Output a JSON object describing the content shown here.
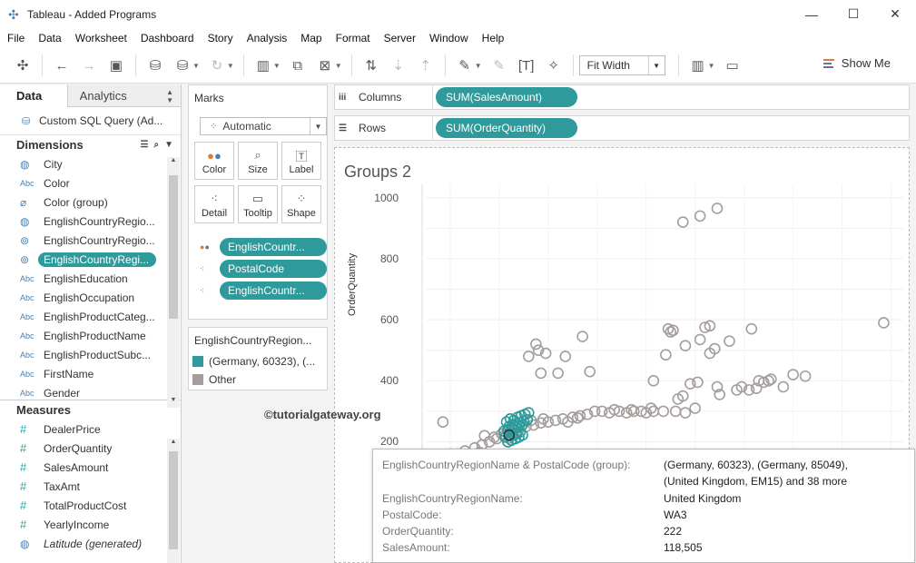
{
  "window": {
    "title": "Tableau - Added Programs",
    "minimize": "—",
    "maximize": "☐",
    "close": "✕"
  },
  "menu": [
    "File",
    "Data",
    "Worksheet",
    "Dashboard",
    "Story",
    "Analysis",
    "Map",
    "Format",
    "Server",
    "Window",
    "Help"
  ],
  "toolbar": {
    "fit": "Fit Width",
    "show_me": "Show Me"
  },
  "data_pane": {
    "tab_data": "Data",
    "tab_analytics": "Analytics",
    "datasource": "Custom SQL Query (Ad...",
    "dimensions_header": "Dimensions",
    "dimensions": [
      {
        "type": "globe",
        "name": "City"
      },
      {
        "type": "Abc",
        "name": "Color"
      },
      {
        "type": "clip",
        "name": "Color (group)"
      },
      {
        "type": "globe",
        "name": "EnglishCountryRegio..."
      },
      {
        "type": "clip2",
        "name": "EnglishCountryRegio..."
      },
      {
        "type": "clip2",
        "name": "EnglishCountryRegi...",
        "selected": true
      },
      {
        "type": "Abc",
        "name": "EnglishEducation"
      },
      {
        "type": "Abc",
        "name": "EnglishOccupation"
      },
      {
        "type": "Abc",
        "name": "EnglishProductCateg..."
      },
      {
        "type": "Abc",
        "name": "EnglishProductName"
      },
      {
        "type": "Abc",
        "name": "EnglishProductSubc..."
      },
      {
        "type": "Abc",
        "name": "FirstName"
      },
      {
        "type": "Abc",
        "name": "Gender"
      }
    ],
    "measures_header": "Measures",
    "measures": [
      {
        "type": "#",
        "name": "DealerPrice"
      },
      {
        "type": "#",
        "name": "OrderQuantity"
      },
      {
        "type": "#",
        "name": "SalesAmount"
      },
      {
        "type": "#",
        "name": "TaxAmt"
      },
      {
        "type": "#",
        "name": "TotalProductCost"
      },
      {
        "type": "#",
        "name": "YearlyIncome"
      },
      {
        "type": "globe",
        "name": "Latitude (generated)",
        "italic": true
      }
    ]
  },
  "marks": {
    "title": "Marks",
    "mark_type": "Automatic",
    "buttons": [
      "Color",
      "Size",
      "Label",
      "Detail",
      "Tooltip",
      "Shape"
    ],
    "pills": [
      "EnglishCountr...",
      "PostalCode",
      "EnglishCountr..."
    ]
  },
  "legend": {
    "title": "EnglishCountryRegion...",
    "items": [
      {
        "label": "(Germany, 60323), (...",
        "color": "#2e9a9c"
      },
      {
        "label": "Other",
        "color": "#a39d9b"
      }
    ]
  },
  "shelves": {
    "columns_label": "Columns",
    "columns_pill": "SUM(SalesAmount)",
    "rows_label": "Rows",
    "rows_pill": "SUM(OrderQuantity)"
  },
  "view": {
    "title": "Groups 2",
    "y_axis_title": "OrderQuantity",
    "watermark": "©tutorialgateway.org"
  },
  "chart_data": {
    "type": "scatter",
    "title": "Groups 2",
    "ylabel": "OrderQuantity",
    "xlabel": "",
    "ylim": [
      130,
      1020
    ],
    "y_ticks": [
      200,
      400,
      600,
      800,
      1000
    ],
    "grid": true,
    "series": [
      {
        "name": "Other",
        "color": "#a39d9b",
        "points": [
          [
            9500,
            920
          ],
          [
            10200,
            940
          ],
          [
            10900,
            965
          ],
          [
            17700,
            590
          ],
          [
            12300,
            570
          ],
          [
            8900,
            570
          ],
          [
            9000,
            560
          ],
          [
            10600,
            580
          ],
          [
            10400,
            575
          ],
          [
            9100,
            565
          ],
          [
            8800,
            485
          ],
          [
            9600,
            515
          ],
          [
            10200,
            535
          ],
          [
            10800,
            505
          ],
          [
            11400,
            530
          ],
          [
            10600,
            490
          ],
          [
            3500,
            520
          ],
          [
            3200,
            480
          ],
          [
            3600,
            500
          ],
          [
            3900,
            490
          ],
          [
            4700,
            480
          ],
          [
            5400,
            545
          ],
          [
            5700,
            430
          ],
          [
            4400,
            425
          ],
          [
            3700,
            425
          ],
          [
            10100,
            395
          ],
          [
            10900,
            380
          ],
          [
            11700,
            370
          ],
          [
            12600,
            400
          ],
          [
            13100,
            405
          ],
          [
            12800,
            395
          ],
          [
            13000,
            400
          ],
          [
            14000,
            420
          ],
          [
            14500,
            415
          ],
          [
            11000,
            355
          ],
          [
            11900,
            380
          ],
          [
            12200,
            370
          ],
          [
            12500,
            375
          ],
          [
            13600,
            380
          ],
          [
            9800,
            390
          ],
          [
            9500,
            350
          ],
          [
            9300,
            340
          ],
          [
            8300,
            400
          ],
          [
            9200,
            300
          ],
          [
            9600,
            295
          ],
          [
            10000,
            310
          ],
          [
            8700,
            300
          ],
          [
            8300,
            300
          ],
          [
            8000,
            295
          ],
          [
            7800,
            300
          ],
          [
            7500,
            300
          ],
          [
            7200,
            295
          ],
          [
            6900,
            300
          ],
          [
            6500,
            295
          ],
          [
            6200,
            300
          ],
          [
            5900,
            300
          ],
          [
            5600,
            290
          ],
          [
            5300,
            285
          ],
          [
            5000,
            280
          ],
          [
            4600,
            275
          ],
          [
            4300,
            270
          ],
          [
            4000,
            265
          ],
          [
            3700,
            262
          ],
          [
            3400,
            255
          ],
          [
            3100,
            250
          ],
          [
            2800,
            240
          ],
          [
            2500,
            230
          ],
          [
            2200,
            220
          ],
          [
            1900,
            210
          ],
          [
            1600,
            200
          ],
          [
            1300,
            190
          ],
          [
            1000,
            180
          ],
          [
            600,
            170
          ],
          [
            300,
            160
          ],
          [
            1100,
            145
          ],
          [
            400,
            140
          ],
          [
            0,
            160
          ],
          [
            -300,
            265
          ],
          [
            1400,
            220
          ],
          [
            1800,
            215
          ],
          [
            2100,
            225
          ],
          [
            2400,
            212
          ],
          [
            2700,
            225
          ],
          [
            2900,
            250
          ],
          [
            3300,
            270
          ],
          [
            3800,
            275
          ],
          [
            4800,
            265
          ],
          [
            5200,
            278
          ],
          [
            6700,
            305
          ],
          [
            7400,
            305
          ],
          [
            8200,
            310
          ],
          [
            1200,
            165
          ],
          [
            800,
            150
          ]
        ]
      },
      {
        "name": "(Germany, 60323), (...",
        "color": "#2e9a9c",
        "points": [
          [
            2300,
            265
          ],
          [
            2450,
            275
          ],
          [
            2600,
            270
          ],
          [
            2750,
            280
          ],
          [
            2900,
            285
          ],
          [
            3050,
            290
          ],
          [
            3200,
            295
          ],
          [
            2400,
            250
          ],
          [
            2550,
            255
          ],
          [
            2700,
            258
          ],
          [
            2850,
            262
          ],
          [
            3000,
            268
          ],
          [
            3150,
            272
          ],
          [
            2200,
            235
          ],
          [
            2350,
            240
          ],
          [
            2500,
            245
          ],
          [
            2650,
            248
          ],
          [
            2800,
            252
          ],
          [
            2950,
            256
          ],
          [
            2250,
            215
          ],
          [
            2400,
            220
          ],
          [
            2550,
            225
          ],
          [
            2700,
            228
          ],
          [
            2850,
            232
          ],
          [
            2350,
            200
          ],
          [
            2500,
            205
          ],
          [
            2650,
            210
          ],
          [
            2800,
            215
          ],
          [
            2950,
            222
          ]
        ]
      }
    ]
  },
  "tooltip": {
    "rows": [
      {
        "label": "EnglishCountryRegionName & PostalCode (group):",
        "value": "(Germany, 60323), (Germany, 85049),",
        "value2": "(United Kingdom, EM15) and 38 more"
      },
      {
        "label": "EnglishCountryRegionName:",
        "value": "United Kingdom"
      },
      {
        "label": "PostalCode:",
        "value": "WA3"
      },
      {
        "label": "OrderQuantity:",
        "value": "222"
      },
      {
        "label": "SalesAmount:",
        "value": "118,505"
      }
    ]
  }
}
